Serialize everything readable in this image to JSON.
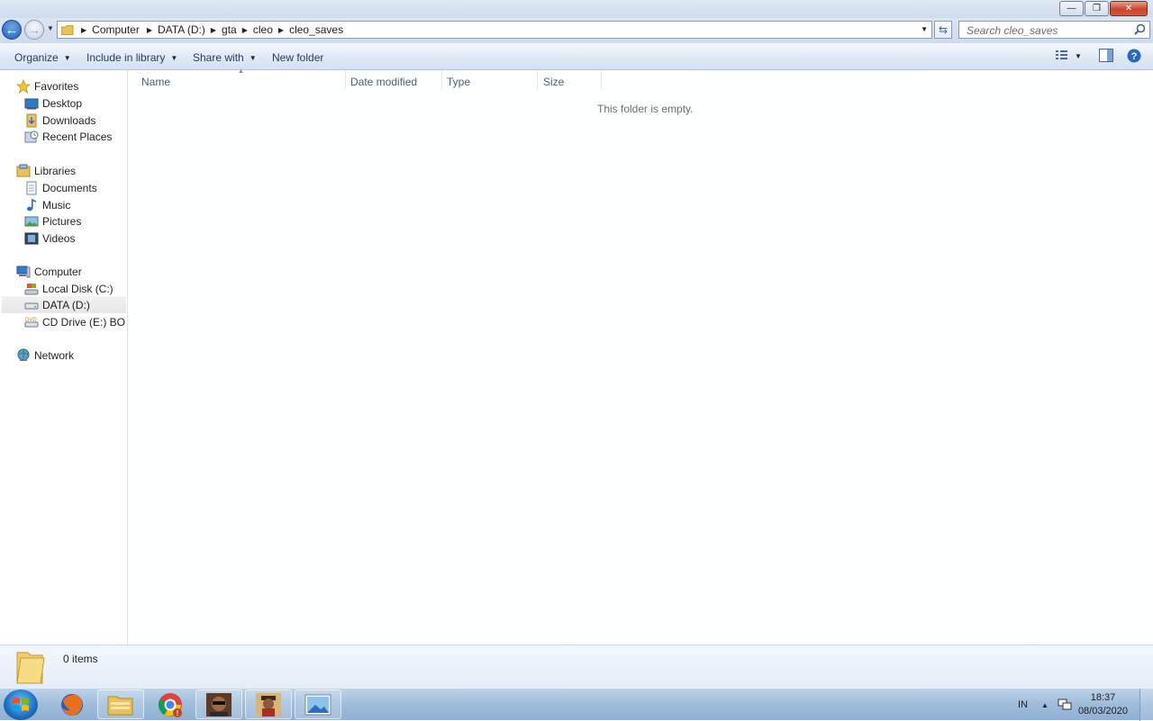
{
  "window": {
    "controls": {
      "minimize": "—",
      "maximize": "❐",
      "close": "✕"
    }
  },
  "address": {
    "crumbs": [
      "Computer",
      "DATA (D:)",
      "gta",
      "cleo",
      "cleo_saves"
    ]
  },
  "search": {
    "placeholder": "Search cleo_saves"
  },
  "toolbar": {
    "organize": "Organize",
    "include_in_library": "Include in library",
    "share_with": "Share with",
    "new_folder": "New folder"
  },
  "nav": {
    "favorites": {
      "label": "Favorites",
      "items": [
        "Desktop",
        "Downloads",
        "Recent Places"
      ]
    },
    "libraries": {
      "label": "Libraries",
      "items": [
        "Documents",
        "Music",
        "Pictures",
        "Videos"
      ]
    },
    "computer": {
      "label": "Computer",
      "items": [
        "Local Disk (C:)",
        "DATA (D:)",
        "CD Drive (E:) BOLT! I"
      ],
      "selected": "DATA (D:)"
    },
    "network": {
      "label": "Network"
    }
  },
  "columns": [
    "Name",
    "Date modified",
    "Type",
    "Size"
  ],
  "content": {
    "empty_message": "This folder is empty."
  },
  "details": {
    "item_count": "0 items"
  },
  "taskbar": {
    "tray_language": "IN",
    "time": "18:37",
    "date": "08/03/2020"
  },
  "colors": {
    "accent": "#1f5db8",
    "command_text": "#1e395b",
    "column_header": "#4c607a",
    "selected_nav": "#e6e6e6"
  }
}
